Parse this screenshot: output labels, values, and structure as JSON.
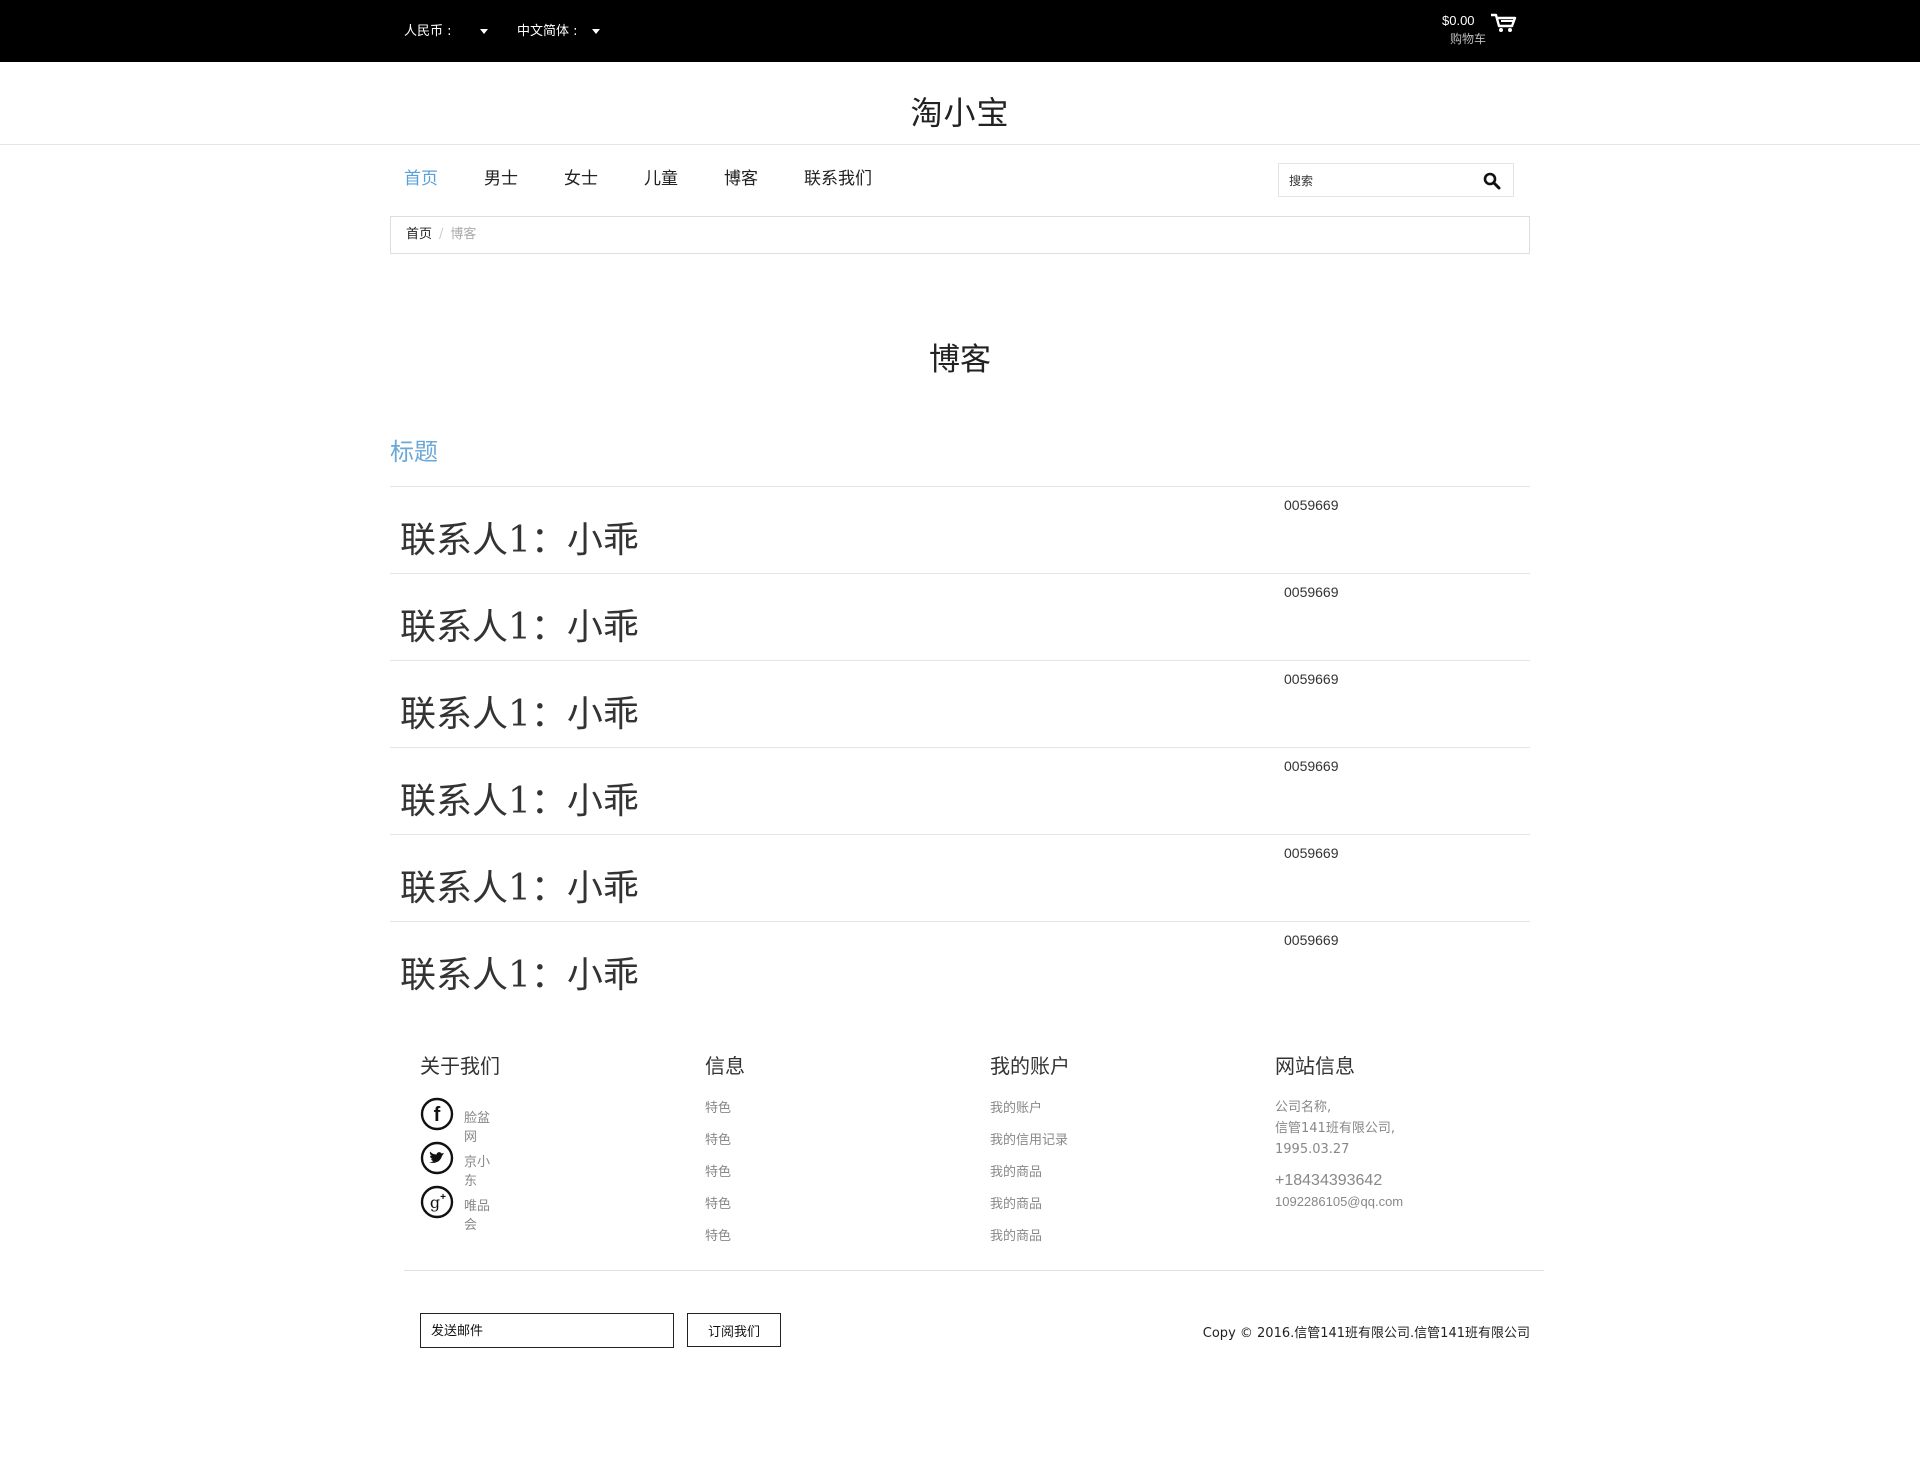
{
  "topbar": {
    "currency": "人民币 :",
    "language": "中文简体 :",
    "cart_total": "$0.00",
    "cart_label": "购物车"
  },
  "brand": "淘小宝",
  "nav": {
    "items": [
      "首页",
      "男士",
      "女士",
      "儿童",
      "博客",
      "联系我们"
    ],
    "active": "首页",
    "search_placeholder": "搜索"
  },
  "breadcrumb": {
    "home": "首页",
    "sep": "/",
    "current": "博客"
  },
  "page_title": "博客",
  "section_title": "标题",
  "entries": [
    {
      "name": "联系人1：小乖",
      "code": "0059669"
    },
    {
      "name": "联系人1：小乖",
      "code": "0059669"
    },
    {
      "name": "联系人1：小乖",
      "code": "0059669"
    },
    {
      "name": "联系人1：小乖",
      "code": "0059669"
    },
    {
      "name": "联系人1：小乖",
      "code": "0059669"
    },
    {
      "name": "联系人1：小乖",
      "code": "0059669"
    }
  ],
  "footer": {
    "about": {
      "title": "关于我们",
      "links": [
        {
          "icon": "facebook-icon",
          "label": "脸盆网"
        },
        {
          "icon": "twitter-icon",
          "label": "京小东"
        },
        {
          "icon": "google-plus-icon",
          "label": "唯品会"
        }
      ]
    },
    "info": {
      "title": "信息",
      "links": [
        "特色",
        "特色",
        "特色",
        "特色",
        "特色"
      ]
    },
    "account": {
      "title": "我的账户",
      "links": [
        "我的账户",
        "我的信用记录",
        "我的商品",
        "我的商品",
        "我的商品"
      ]
    },
    "site": {
      "title": "网站信息",
      "lines": [
        "公司名称,",
        "信管141班有限公司,",
        "1995.03.27"
      ],
      "phone": "+18434393642",
      "email": "1092286105@qq.com"
    },
    "email_placeholder": "发送邮件",
    "subscribe_label": "订阅我们",
    "copyright": "Copy © 2016.信管141班有限公司.信管141班有限公司"
  }
}
